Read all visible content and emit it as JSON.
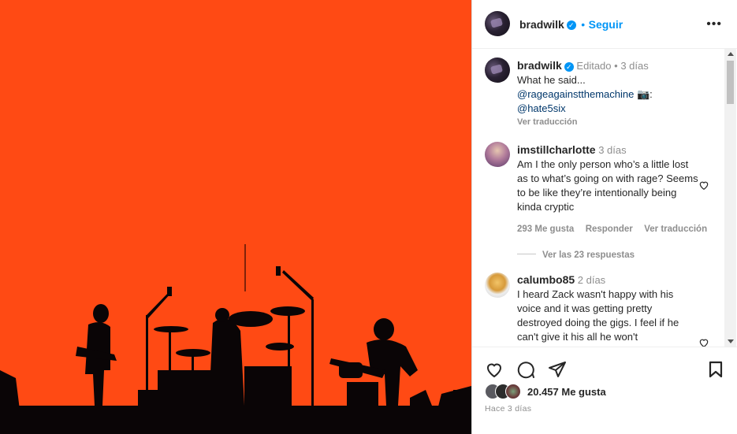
{
  "post": {
    "username": "bradwilk",
    "follow_label": "Seguir",
    "more_label": "•••",
    "caption": {
      "username": "bradwilk",
      "edited": "Editado",
      "separator": "•",
      "time": "3 días",
      "line1": "What he said...",
      "mention1": "@rageagainstthemachine",
      "camera": "📷:",
      "mention2": "@hate5six",
      "translate": "Ver traducción"
    },
    "comments": [
      {
        "username": "imstillcharlotte",
        "time": "3 días",
        "text": "Am I the only person who’s a little lost as to what’s going on with rage? Seems to be like they’re intentionally being kinda cryptic",
        "likes": "293 Me gusta",
        "reply": "Responder",
        "translate": "Ver traducción",
        "view_replies": "Ver las 23 respuestas"
      },
      {
        "username": "calumbo85",
        "time": "2 días",
        "text": "I heard Zack wasn't happy with his voice and it was getting pretty destroyed doing the gigs. I feel if he can't give it his all he won't"
      }
    ],
    "likes_count": "20.457 Me gusta",
    "posted": "Hace 3 días"
  },
  "colors": {
    "photo_bg": "#ff4a14",
    "accent": "#0095f6"
  },
  "icons": [
    "heart-icon",
    "comment-icon",
    "share-icon",
    "bookmark-icon",
    "verified-icon",
    "more-icon"
  ]
}
